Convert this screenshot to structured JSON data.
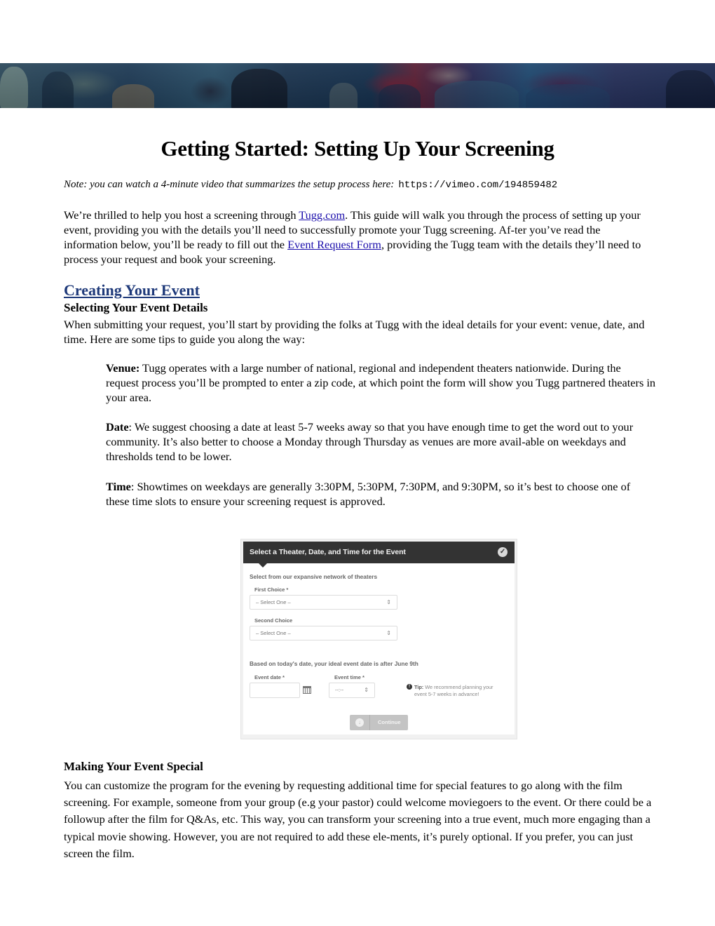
{
  "banner": {
    "image_description": "Film still: crowd of costumed figures in a medieval hall with red curtains and banners"
  },
  "document": {
    "title": "Getting Started: Setting Up Your Screening",
    "note": {
      "text": "Note: you can watch a 4-minute video that summarizes the setup process here:",
      "url": "https://vimeo.com/194859482"
    },
    "intro": {
      "part1": "We’re thrilled to help you host a screening through ",
      "link1": "Tugg.com",
      "part2": ". This guide will walk you through the process of setting up your event, providing you with the details you’ll need to successfully promote your Tugg screening. Af-ter you’ve read the information below, you’ll be ready to fill out the ",
      "link2": "Event Request Form",
      "part3": ", providing the Tugg team with the details they’ll need to process your request and book your screening."
    },
    "creating": {
      "heading": "Creating Your Event",
      "subheading": "Selecting Your Event Details",
      "text": "When submitting your request, you’ll start by providing the folks at Tugg with the ideal details for your event: venue, date, and time. Here are some tips to guide you along the way:",
      "tips": [
        {
          "label": "Venue:",
          "text": " Tugg operates with a large number of national, regional and independent theaters nationwide. During the request process you’ll be prompted to enter a zip code, at which point the form will show you Tugg partnered theaters in your area."
        },
        {
          "label": "Date",
          "text": ": We suggest choosing a date at least 5-7 weeks away so that you have enough time to get the word out to your community. It’s also better to choose a Monday through Thursday as venues are more avail-able on weekdays and thresholds tend to be lower."
        },
        {
          "label": "Time",
          "text": ": Showtimes on weekdays are generally 3:30PM, 5:30PM, 7:30PM, and 9:30PM, so it’s best to choose one of these time slots to ensure your screening request is approved."
        }
      ]
    },
    "form_screenshot": {
      "header": "Select a Theater, Date, and Time for the Event",
      "theaters_section": "Select from our expansive network of theaters",
      "first_choice_label": "First Choice *",
      "first_choice_value": "– Select One –",
      "second_choice_label": "Second Choice",
      "second_choice_value": "– Select One –",
      "date_section": "Based on today's date, your ideal event date is after June 9th",
      "event_date_label": "Event date *",
      "event_date_value": "",
      "event_time_label": "Event time *",
      "event_time_value": "--:--",
      "tip_label": "Tip:",
      "tip_text": " We recommend planning your event 5-7 weeks in advance!",
      "continue_label": "Continue",
      "icons": {
        "header": "check-circle-icon",
        "date": "calendar-icon",
        "tip": "exclamation-icon",
        "continue": "arrow-down-circle-icon"
      }
    },
    "special": {
      "heading": "Making Your Event Special",
      "text": "You can customize the program for the evening by requesting additional time for special features to go along with the film screening. For example, someone from your group (e.g your pastor) could welcome moviegoers to the event. Or there could be a followup after the film for Q&As, etc.  This way, you can transform your screening into a true event, much more engaging than a typical movie showing. However, you are not required to add these ele-ments, it’s purely optional. If you prefer, you can just screen the film."
    }
  }
}
